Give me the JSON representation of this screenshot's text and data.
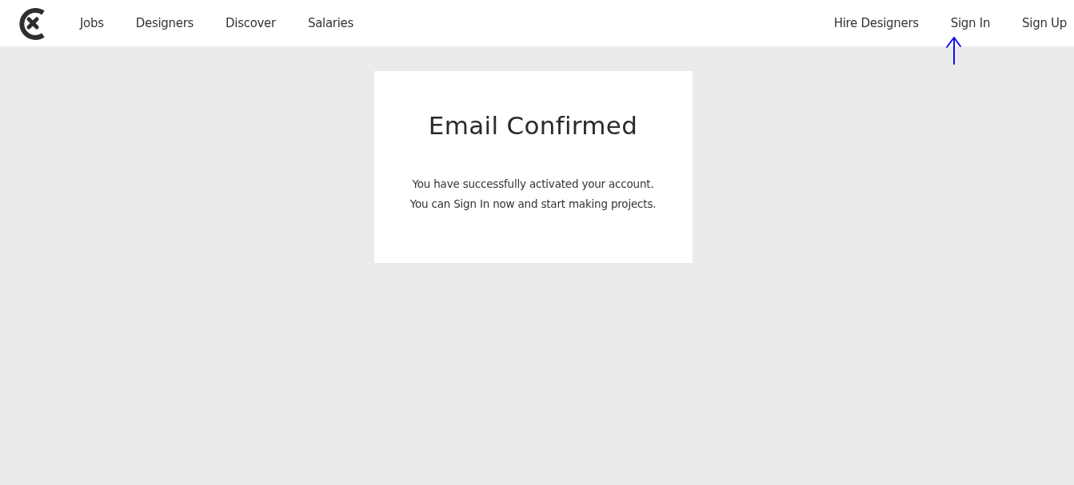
{
  "nav_left": [
    "Jobs",
    "Designers",
    "Discover",
    "Salaries"
  ],
  "nav_right": [
    "Hire Designers",
    "Sign In",
    "Sign Up"
  ],
  "card": {
    "title": "Email Confirmed",
    "lines": [
      "You have successfully activated your account.",
      "You can Sign In now and start making projects."
    ]
  }
}
